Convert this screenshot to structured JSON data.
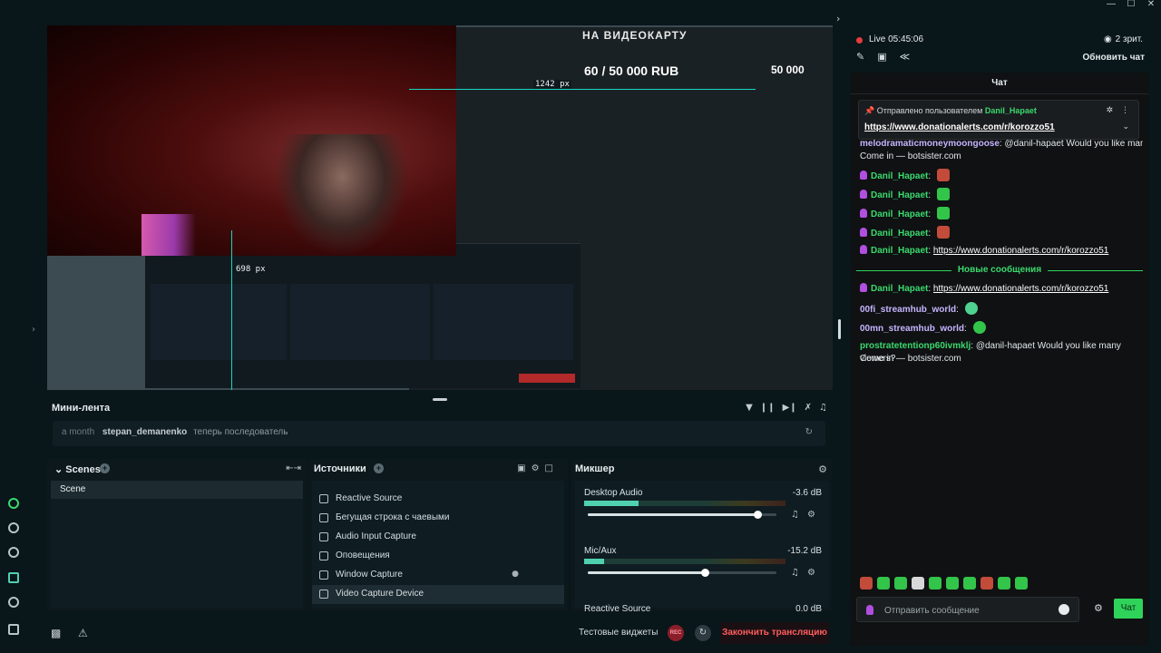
{
  "window_controls": {
    "minimize": "—",
    "maximize": "☐",
    "close": "✕"
  },
  "preview": {
    "overlay_title": "НА ВИДЕОКАРТУ",
    "goal_text": "60 / 50 000 RUB",
    "goal_target": "50 000",
    "guide_h_label": "1242 px",
    "guide_v_label": "698 px"
  },
  "mini_feed": {
    "title": "Мини-лента",
    "row": {
      "time": "a month",
      "user": "stepan_demanenko",
      "action": "теперь последователь"
    }
  },
  "scenes": {
    "title": "Scenes",
    "items": [
      "Scene"
    ]
  },
  "sources": {
    "title": "Источники",
    "items": [
      "Reactive Source",
      "Бегущая строка с чаевыми",
      "Audio Input Capture",
      "Оповещения",
      "Window Capture",
      "Video Capture Device"
    ],
    "active_index": 5
  },
  "mixer": {
    "title": "Микшер",
    "channels": [
      {
        "name": "Desktop Audio",
        "db": "-3.6 dB",
        "level": 0.27,
        "volume": 0.9
      },
      {
        "name": "Mic/Aux",
        "db": "-15.2 dB",
        "level": 0.1,
        "volume": 0.62
      },
      {
        "name": "Reactive Source",
        "db": "0.0 dB"
      }
    ]
  },
  "footer": {
    "test_widgets": "Тестовые виджеты",
    "rec": "REC",
    "end_stream": "Закончить трансляцию"
  },
  "side": {
    "live": "Live 05:45:06",
    "viewers": "2 зрит.",
    "refresh_chat": "Обновить чат"
  },
  "chat": {
    "title": "Чат",
    "pinned": {
      "header": "Отправлено пользователем",
      "user": "Danil_Hapaet",
      "link": "https://www.donationalerts.com/r/korozzo51"
    },
    "partial_user": "melodramaticmoneymoongoose",
    "partial_text": "@danil-hapaet Would you like many viewers?",
    "partial_cont": "Come in — botsister.com",
    "messages": [
      {
        "user": "Danil_Hapaet",
        "emote": "red"
      },
      {
        "user": "Danil_Hapaet",
        "emote": "green"
      },
      {
        "user": "Danil_Hapaet",
        "emote": "green"
      },
      {
        "user": "Danil_Hapaet",
        "emote": "red"
      },
      {
        "user": "Danil_Hapaet",
        "text": "https://www.donationalerts.com/r/korozzo51"
      }
    ],
    "new_messages_label": "Новые сообщения",
    "new_messages": [
      {
        "user": "Danil_Hapaet",
        "text": "https://www.donationalerts.com/r/korozzo51"
      },
      {
        "user": "00fi_streamhub_world"
      },
      {
        "user": "00mn_streamhub_world"
      },
      {
        "user": "prostratetentionp60ivmklj",
        "text": "@danil-hapaet Would you like many viewers?",
        "cont": "Come in — botsister.com"
      }
    ],
    "input_placeholder": "Отправить сообщение",
    "send_label": "Чат"
  }
}
